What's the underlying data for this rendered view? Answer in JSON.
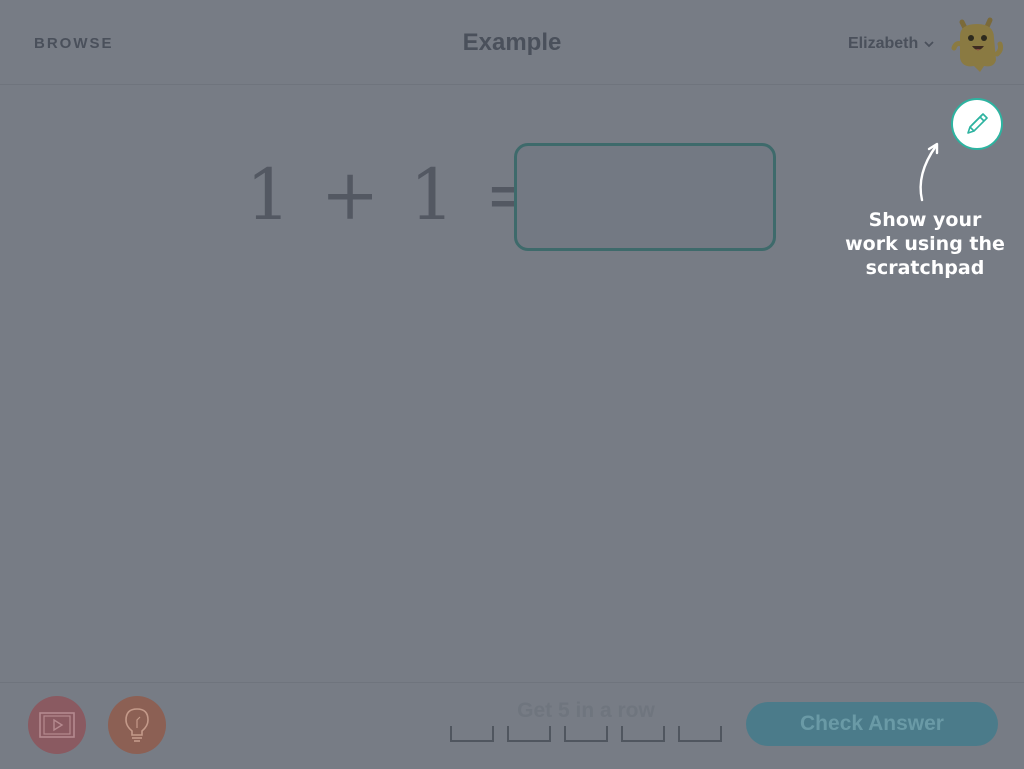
{
  "header": {
    "browse_label": "BROWSE",
    "title": "Example",
    "user_name": "Elizabeth",
    "avatar_icon": "monster-avatar-icon"
  },
  "problem": {
    "equation": "1 + 1 =",
    "answer_value": ""
  },
  "scratchpad": {
    "button_icon": "pencil-icon",
    "tip_line1": "Show your",
    "tip_line2": "work using the",
    "tip_line3": "scratchpad"
  },
  "footer": {
    "video_icon": "video-icon",
    "hint_icon": "lightbulb-icon",
    "streak_label": "Get 5 in a row",
    "streak_slots": 5,
    "streak_filled": 0,
    "check_label": "Check Answer"
  },
  "colors": {
    "overlay": "#777c85",
    "accent_teal": "#2db3a0",
    "check_button": "#4b7b8a"
  }
}
